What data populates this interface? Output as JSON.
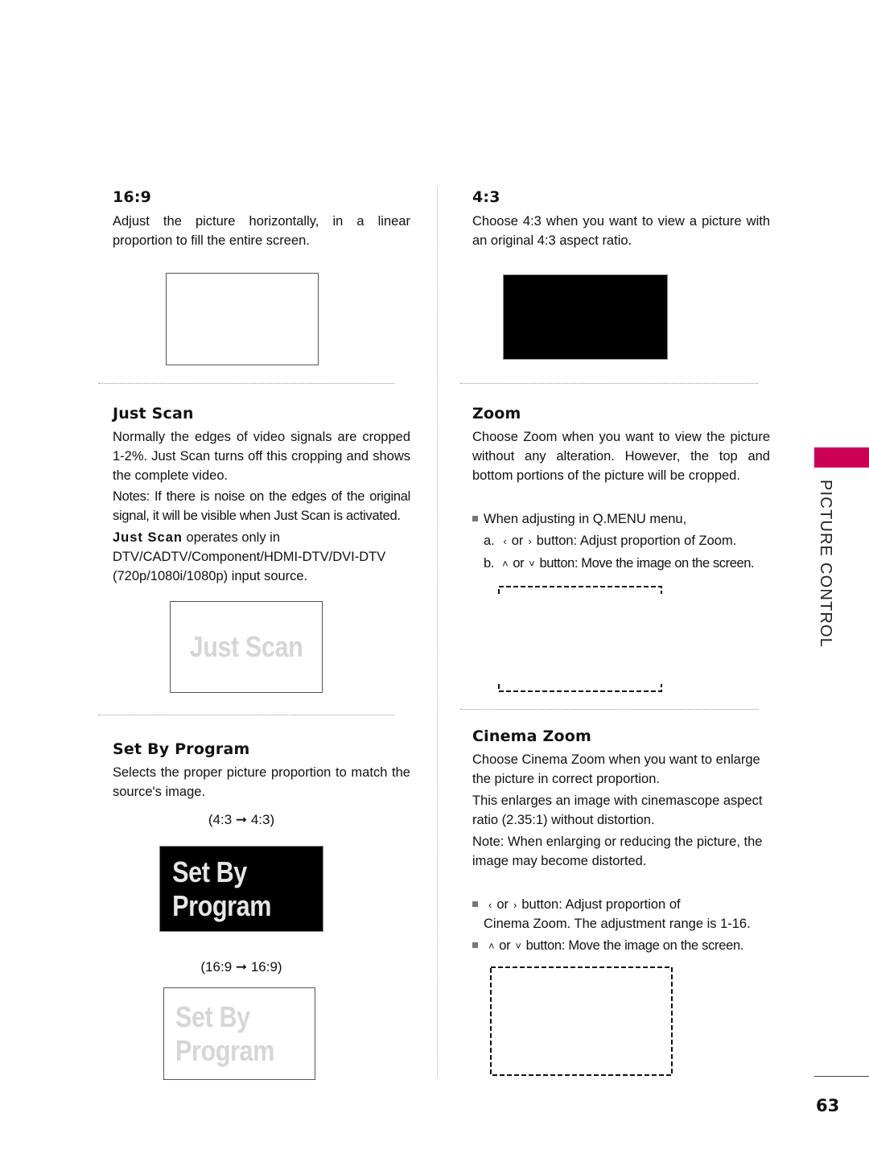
{
  "sections": {
    "s169": {
      "title": "16:9",
      "body": "Adjust the picture horizontally, in a linear proportion to fill the entire screen."
    },
    "s43": {
      "title": "4:3",
      "body": "Choose 4:3 when you want to view a picture with an original 4:3 aspect ratio."
    },
    "just_scan": {
      "title": "Just Scan",
      "body1": "Normally the edges of video signals are cropped 1-2%. Just Scan turns off this cropping and shows the complete video.",
      "body2": "Notes: If there is noise on the edges of the original signal, it will be visible when Just Scan is activated.",
      "body3_bold": "Just Scan",
      "body3_rest": " operates only in DTV/CADTV/Component/HDMI-DTV/DVI-DTV (720p/1080i/1080p) input source.",
      "image_label": "Just Scan"
    },
    "zoom": {
      "title": "Zoom",
      "body": "Choose Zoom when you want to view the picture without any alteration. However, the top and bottom portions of the picture will be cropped.",
      "bullet": "When adjusting in Q.MENU menu,",
      "item_a_prefix": "a.",
      "item_a_or": "or",
      "item_a_text": "button: Adjust proportion of Zoom.",
      "item_b_prefix": "b.",
      "item_b_or": "or",
      "item_b_text": "button: Move the image on the screen."
    },
    "set_by_program": {
      "title": "Set By Program",
      "body": "Selects the proper picture proportion to match the source's image.",
      "caption_43": "(4:3 ➞ 4:3)",
      "caption_169": "(16:9 ➞ 16:9)",
      "image_label": "Set By Program"
    },
    "cinema_zoom": {
      "title": "Cinema Zoom",
      "body1": "Choose Cinema Zoom when you want to enlarge the picture in correct proportion.",
      "body2": "This enlarges an image with cinemascope aspect ratio (2.35:1) without distortion.",
      "body3": "Note: When enlarging or reducing the picture, the image may become distorted.",
      "bullet1_or": "or",
      "bullet1_text": "button: Adjust proportion of",
      "bullet1_cont": "Cinema Zoom. The adjustment range is 1-16.",
      "bullet2_or": "or",
      "bullet2_text": "button: Move the image on the screen."
    }
  },
  "icons": {
    "left": "<",
    "right": ">",
    "up": "^",
    "down": "v"
  },
  "sidebar": {
    "label": "PICTURE CONTROL",
    "accent_color": "#cc0055"
  },
  "page_number": "63"
}
